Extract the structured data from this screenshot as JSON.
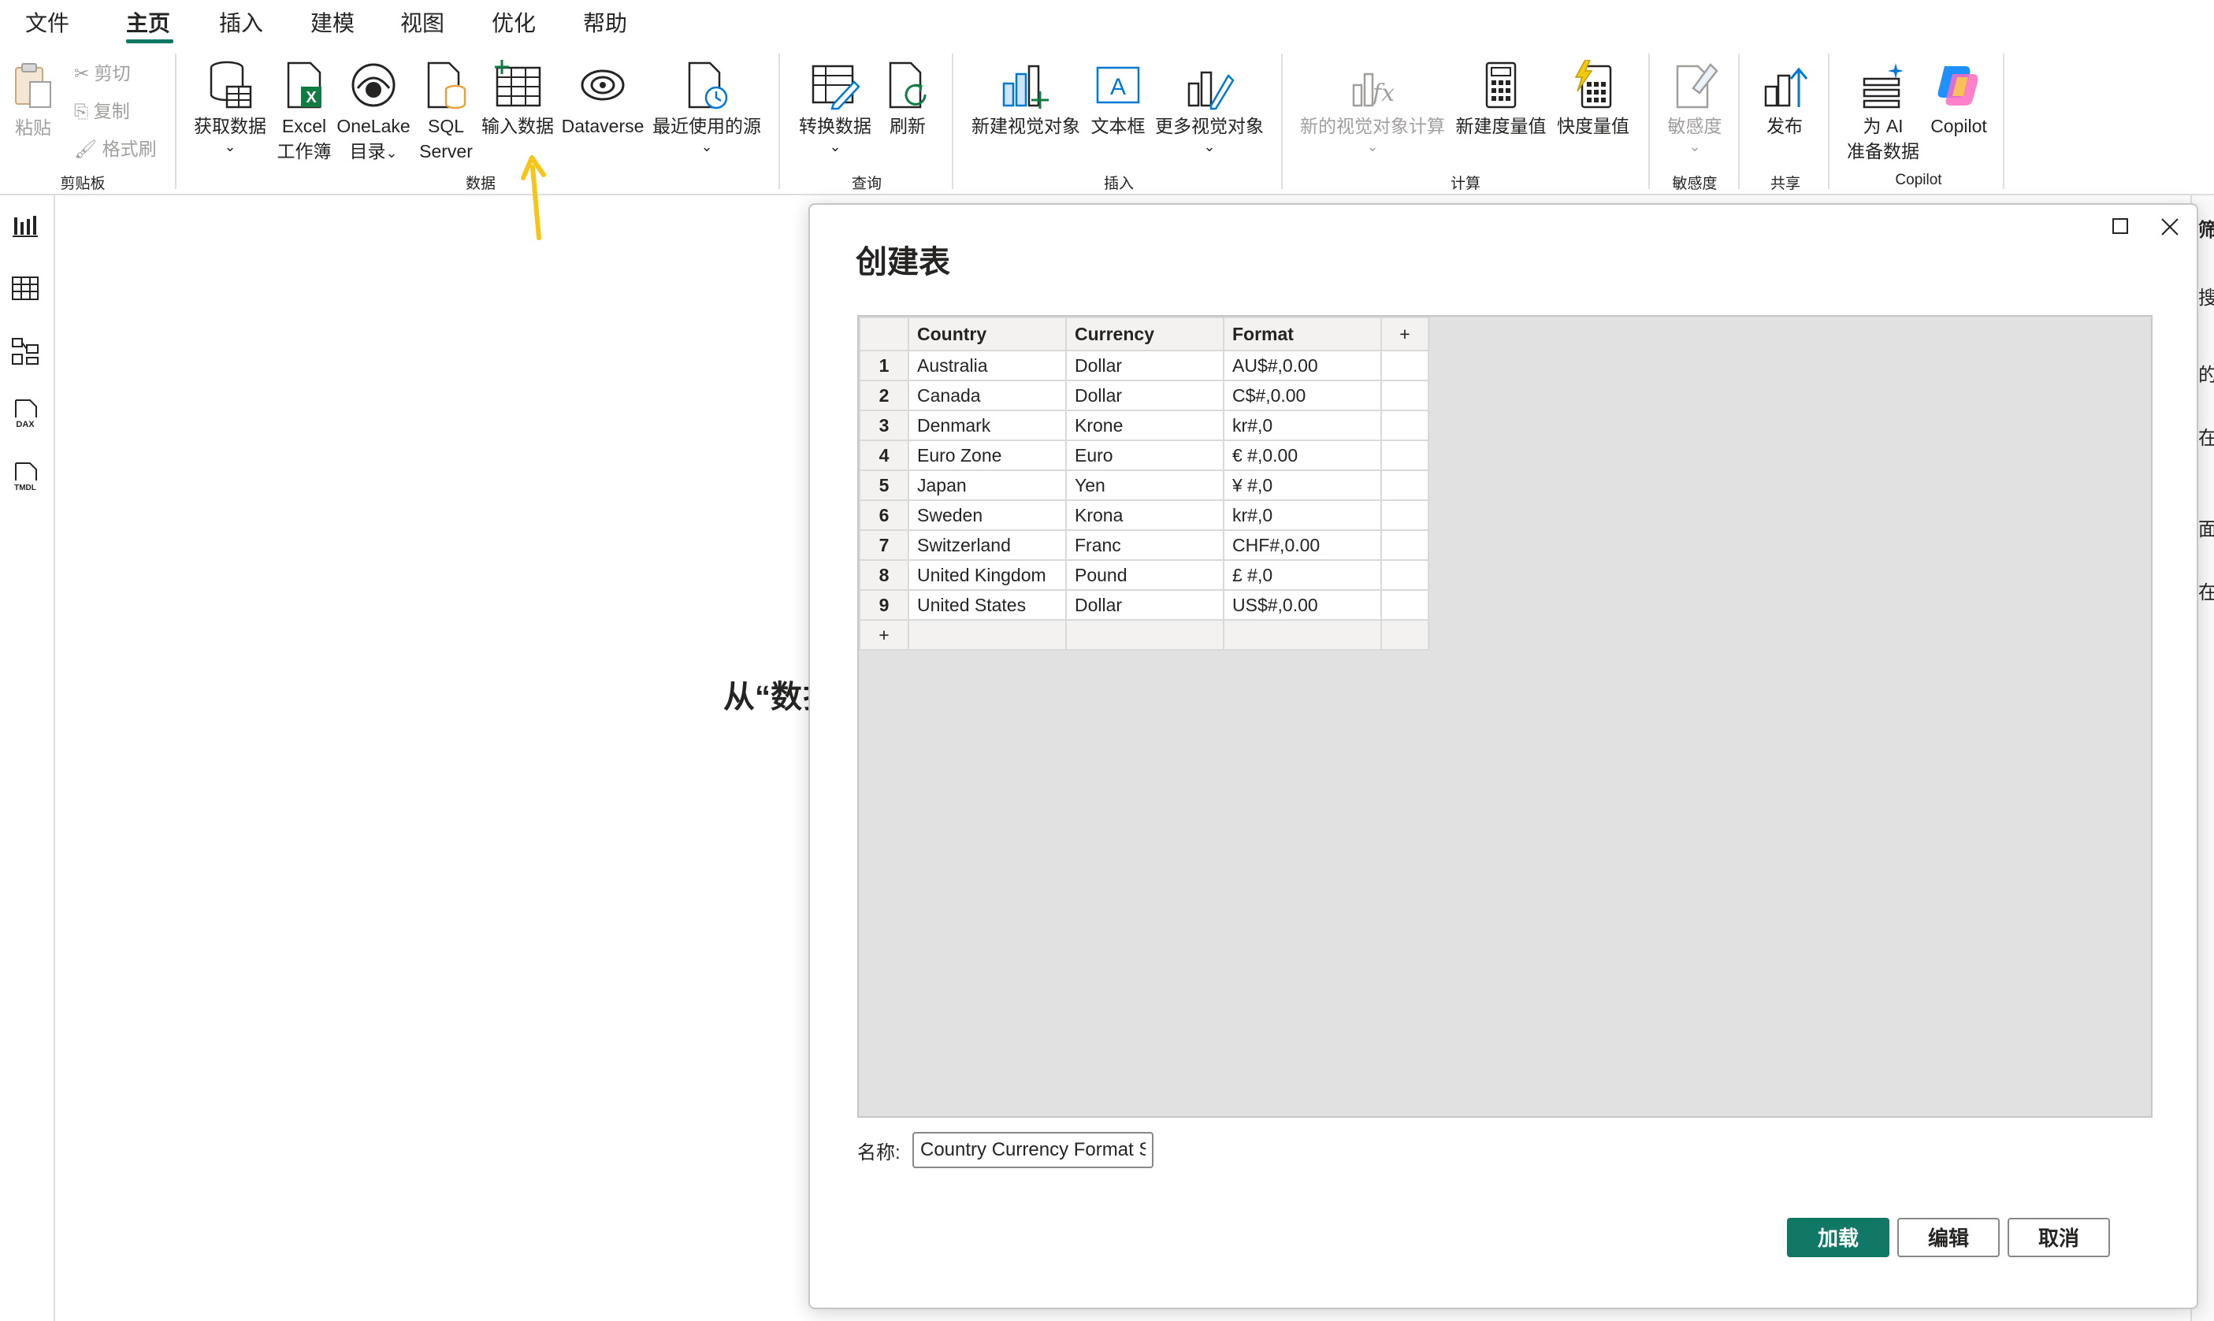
{
  "menu": {
    "items": [
      "文件",
      "主页",
      "插入",
      "建模",
      "视图",
      "优化",
      "帮助"
    ],
    "active": "主页"
  },
  "ribbon": {
    "clipboard": {
      "paste": "粘贴",
      "cut": "剪切",
      "copy": "复制",
      "format_painter": "格式刷",
      "group": "剪贴板"
    },
    "data": {
      "get_data": "获取数据",
      "excel_line1": "Excel",
      "excel_line2": "工作簿",
      "onelake_line1": "OneLake",
      "onelake_line2": "目录",
      "sql_line1": "SQL",
      "sql_line2": "Server",
      "enter_data": "输入数据",
      "dataverse": "Dataverse",
      "recent_sources": "最近使用的源",
      "group": "数据"
    },
    "queries": {
      "transform": "转换数据",
      "refresh": "刷新",
      "group": "查询"
    },
    "insert": {
      "new_visual": "新建视觉对象",
      "text_box": "文本框",
      "more_visuals": "更多视觉对象",
      "group": "插入"
    },
    "calculations": {
      "new_visual_calc": "新的视觉对象计算",
      "new_measure": "新建度量值",
      "quick_measure": "快度量值",
      "group": "计算"
    },
    "sensitivity": {
      "label": "敏感度",
      "group": "敏感度"
    },
    "share": {
      "publish": "发布",
      "group": "共享"
    },
    "copilot": {
      "prep_line1": "为 AI",
      "prep_line2": "准备数据",
      "copilot": "Copilot",
      "group": "Copilot"
    }
  },
  "canvas": {
    "partial_text": "从“数扌"
  },
  "rightpane": {
    "items": [
      "筛",
      "搜",
      "的",
      "在",
      "面",
      "在"
    ]
  },
  "dialog": {
    "title": "创建表",
    "columns": [
      "Country",
      "Currency",
      "Format"
    ],
    "add_column": "+",
    "add_row": "+",
    "rows": [
      {
        "n": "1",
        "country": "Australia",
        "currency": "Dollar",
        "format": "AU$#,0.00"
      },
      {
        "n": "2",
        "country": "Canada",
        "currency": "Dollar",
        "format": "C$#,0.00"
      },
      {
        "n": "3",
        "country": "Denmark",
        "currency": "Krone",
        "format": "kr#,0"
      },
      {
        "n": "4",
        "country": "Euro Zone",
        "currency": "Euro",
        "format": "€ #,0.00"
      },
      {
        "n": "5",
        "country": "Japan",
        "currency": "Yen",
        "format": "¥ #,0"
      },
      {
        "n": "6",
        "country": "Sweden",
        "currency": "Krona",
        "format": "kr#,0"
      },
      {
        "n": "7",
        "country": "Switzerland",
        "currency": "Franc",
        "format": "CHF#,0.00"
      },
      {
        "n": "8",
        "country": "United Kingdom",
        "currency": "Pound",
        "format": "£ #,0"
      },
      {
        "n": "9",
        "country": "United States",
        "currency": "Dollar",
        "format": "US$#,0.00"
      }
    ],
    "name_label": "名称:",
    "name_value": "Country Currency Format Strings",
    "load": "加载",
    "edit": "编辑",
    "cancel": "取消"
  },
  "colors": {
    "accent": "#117865",
    "arrow": "#f5c518"
  }
}
